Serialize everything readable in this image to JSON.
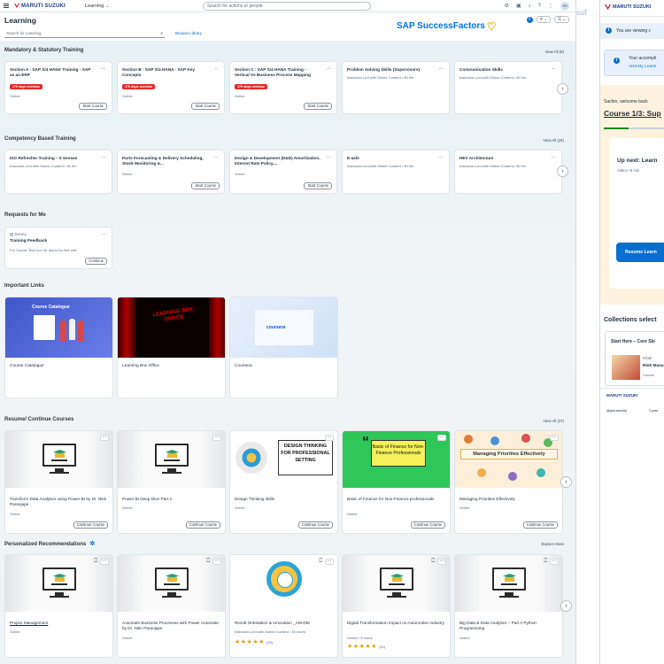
{
  "header": {
    "brand": "MARUTI SUZUKI",
    "product": "Learning",
    "search_placeholder": "Search for actions or people",
    "avatar": "SS"
  },
  "title_bar": {
    "title": "Learning",
    "search_placeholder": "Search for Learning",
    "browse_library": "Browse Library",
    "sf_logo": "SAP SuccessFactors"
  },
  "sections": {
    "mandatory": {
      "title": "Mandatory & Statutory Training",
      "view_all": "View All (8)",
      "cards": [
        {
          "title": "Section A : SAP S/4 HANA Training - SAP as an ERP",
          "badge": "176 days overdue",
          "meta": "Online",
          "action": "Start Course"
        },
        {
          "title": "Section B : SAP S/4 HANA - SAP Key Concepts",
          "badge": "176 days overdue",
          "meta": "Online",
          "action": "Start Course"
        },
        {
          "title": "Section C : SAP S/4 HANA Training - Vertical Vs Business Process Mapping",
          "badge": "176 days overdue",
          "meta": "Online",
          "action": "Start Course"
        },
        {
          "title": "Problem Solving Skills (Supervisors)",
          "meta": "Instructor-Led with Online Content • 8h 0m"
        },
        {
          "title": "Communication Skills",
          "meta": "Instructor-Led with Online Content • 8h 0m"
        }
      ]
    },
    "competency": {
      "title": "Competency Based Training",
      "view_all": "View All (25)",
      "cards": [
        {
          "title": "ISO Refresher Training – 5 Senses",
          "meta": "Instructor-Led with Online Content • 3h 0m"
        },
        {
          "title": "Parts Forecasting & Delivery Scheduling, Stock Monitoring &...",
          "meta": "Online",
          "action": "Start Course"
        },
        {
          "title": "Design & Development (D&D) Amortization, Interest Rate Policy,...",
          "meta": "Online",
          "action": "Start Course"
        },
        {
          "title": "E-axle",
          "meta": "Instructor-Led with Online Content • 8h 0m"
        },
        {
          "title": "HEV Architecture",
          "meta": "Instructor-Led with Online Content • 8h 0m"
        }
      ]
    },
    "requests": {
      "title": "Requests for Me",
      "card": {
        "type": "Survey",
        "title": "Training Feedback",
        "meta": "For Course Test icon for demo-Do Not Use",
        "action": "Continue"
      }
    },
    "links": {
      "title": "Important Links",
      "cards": [
        {
          "title": "Course Catalogue",
          "image_text": "Course Catalogue"
        },
        {
          "title": "Learning Box Office",
          "image_text": "LEARNING BOX OFFICE"
        },
        {
          "title": "Coursera",
          "image_text": "coursera"
        }
      ]
    },
    "resume": {
      "title": "Resume/ Continue Courses",
      "view_all": "View All (37)",
      "cards": [
        {
          "title": "Transform Data Analytics using Power BI by Dr. Nitin Paranjape",
          "meta": "Online",
          "action": "Continue Course"
        },
        {
          "title": "Power BI Deep Dive Part-1",
          "meta": "Online",
          "action": "Continue Course"
        },
        {
          "title": "Design Thinking skills",
          "meta": "Online",
          "action": "Continue Course",
          "image_text": "DESIGN THINKING FOR PROFESSIONAL SETTING"
        },
        {
          "title": "Basic of Finance for Non-Finance professionals",
          "meta": "Online",
          "action": "Continue Course",
          "image_text": "Basic of Finance for Non-Finance Professionals"
        },
        {
          "title": "Managing Priorities Effectively",
          "meta": "Online",
          "action": "Continue Course",
          "image_text": "Managing Priorities Effectively"
        }
      ]
    },
    "recommendations": {
      "title": "Personalized Recommendations",
      "explore": "Explore More",
      "cards": [
        {
          "title": "Project Management",
          "meta": "Online"
        },
        {
          "title": "Automate Business Processes with Power Automate by Dr. Nitin Paranjape",
          "meta": "Online"
        },
        {
          "title": "Result Orientation & Innovation _AM-DM",
          "meta": "Instructor-Led with Online Content • 16 hours",
          "rating": "★★★★★",
          "rating_count": "(15)"
        },
        {
          "title": "Digital Transformation Impact on Automotive Industry",
          "meta": "Online • 3 hours",
          "rating": "★★★★★",
          "rating_count": "(10)"
        },
        {
          "title": "Big Data & Data Analytics – Part A Python Programming",
          "meta": "Online"
        }
      ]
    }
  },
  "right_panel": {
    "clipped_text": "ssif",
    "brand": "MARUTI SUZUKI",
    "info_text": "You are viewing c",
    "accomplish_text": "Your accompli",
    "accomplish_link": "Visit My Learni",
    "welcome": "Sachin, welcome back",
    "course": "Course 1/3: Sup",
    "progress": 0.4,
    "up_next": "Up next: Learn",
    "up_next_meta": "Video • 9 min",
    "resume_button": "Resume Learn",
    "collections_title": "Collections select",
    "collection_card_title": "Start Here – Core Ski",
    "collection_item_author": "Khali",
    "collection_item_title": "Risk Mana",
    "collection_item_type": "Course",
    "footer_brand": "MARUTI SUZUKI",
    "footer_left": "@pluraecsity",
    "footer_right": "Cyrse"
  }
}
